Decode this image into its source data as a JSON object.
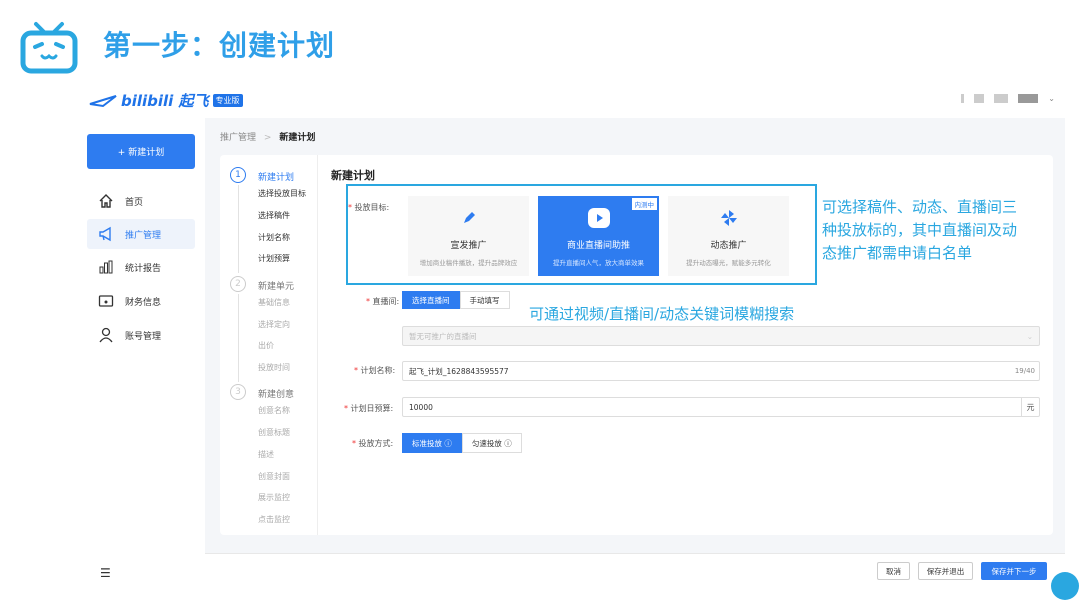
{
  "slide": {
    "title": "第一步：创建计划"
  },
  "app": {
    "brand": "bilibili 起飞",
    "brand_badge": "专业版",
    "sidebar": {
      "new_plan_button": "+ 新建计划",
      "items": [
        {
          "label": "首页",
          "icon": "home-icon"
        },
        {
          "label": "推广管理",
          "icon": "megaphone-icon"
        },
        {
          "label": "统计报告",
          "icon": "bar-chart-icon"
        },
        {
          "label": "财务信息",
          "icon": "wallet-icon"
        },
        {
          "label": "账号管理",
          "icon": "user-icon"
        }
      ]
    },
    "breadcrumb": {
      "parent": "推广管理",
      "separator": ">",
      "current": "新建计划"
    },
    "steps": [
      {
        "num": "1",
        "title": "新建计划",
        "subs": [
          "选择投放目标",
          "选择稿件",
          "计划名称",
          "计划预算"
        ]
      },
      {
        "num": "2",
        "title": "新建单元",
        "subs": [
          "基础信息",
          "选择定向",
          "出价",
          "投放时间"
        ]
      },
      {
        "num": "3",
        "title": "新建创意",
        "subs": [
          "创意名称",
          "创意标题",
          "描述",
          "创意封面",
          "展示监控",
          "点击监控"
        ]
      }
    ],
    "form": {
      "title": "新建计划",
      "goal_label": "投放目标:",
      "goal_cards": [
        {
          "title": "宣发推广",
          "desc": "增加商业稿件播放，提升品牌效应"
        },
        {
          "title": "商业直播间助推",
          "desc": "提升直播间人气，放大商单效果",
          "tag": "内测中"
        },
        {
          "title": "动态推广",
          "desc": "提升动态曝光，赋能多元转化"
        }
      ],
      "live_label": "直播间:",
      "live_options": [
        "选择直播间",
        "手动填写"
      ],
      "live_placeholder": "暂无可推广的直播间",
      "plan_name_label": "计划名称:",
      "plan_name_value": "起飞_计划_1628843595577",
      "plan_name_counter": "19/40",
      "budget_label": "计划日预算:",
      "budget_value": "10000",
      "budget_unit": "元",
      "method_label": "投放方式:",
      "method_options": [
        "标准投放 ⓘ",
        "匀速投放 ⓘ"
      ]
    },
    "footer": {
      "cancel": "取消",
      "save_exit": "保存并退出",
      "save_next": "保存并下一步"
    }
  },
  "annotations": {
    "goal_note": "可选择稿件、动态、直播间三种投放标的，其中直播间及动态推广都需申请白名单",
    "goal_note_lines": [
      "可选择稿件、动态、直播间三",
      "种投放标的，其中直播间及动",
      "态推广都需申请白名单"
    ],
    "search_note": "可通过视频/直播间/动态关键词模糊搜索"
  },
  "colors": {
    "brand": "#2e7cf0",
    "annotation": "#2aa7e0"
  }
}
